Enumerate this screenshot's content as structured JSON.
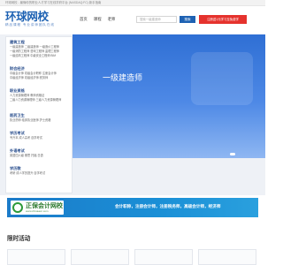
{
  "topbar": {
    "text": "环球网校 - 最懂你的职业人才学习在线学府平台  (NASDAQ:FC)  新手指南"
  },
  "header": {
    "logo_main": "环球网校",
    "logo_sub": "精品课程  专业讲师团队在线",
    "nav": [
      "首页",
      "课程",
      "老师"
    ],
    "search_placeholder": "搜索一级建造师",
    "search_button": "搜索",
    "promo_button": "注册送1元学习至免费学"
  },
  "sidebar": {
    "categories": [
      {
        "title": "建筑工程",
        "lines": [
          "一级建造师  二级建造师  一级造价工程师",
          "一级消防工程师  咨询工程师  监理工程师",
          "一级结构工程师  中级安全工程师  BIM"
        ]
      },
      {
        "title": "财会经济",
        "lines": [
          "中级会计师  初级会计职称  注册会计师",
          "中级经济师  初级经济师  税务师"
        ]
      },
      {
        "title": "职业资格",
        "lines": [
          "人力资源管理师  教师资格证",
          "二级人力资源管理师  三级人力资源管理师"
        ]
      },
      {
        "title": "医药卫生",
        "lines": [
          "执业药师  临床执业医师  护士资格"
        ]
      },
      {
        "title": "学历考试",
        "lines": [
          "专升本  成人高考  自学考试"
        ]
      },
      {
        "title": "外语考试",
        "lines": [
          "英语四六级  雅思  托福  日语"
        ]
      },
      {
        "title": "学历教",
        "lines": [
          "考研  成人学历提升  自学考试"
        ]
      }
    ]
  },
  "banner": {
    "title": "一级建造师"
  },
  "ad": {
    "logo_text": "正保会计网校",
    "logo_url": "www.chinaacc.com",
    "text": "会计职称，注册会计师，注册税务师，高级会计师，经济师"
  },
  "section": {
    "title": "限时活动"
  }
}
